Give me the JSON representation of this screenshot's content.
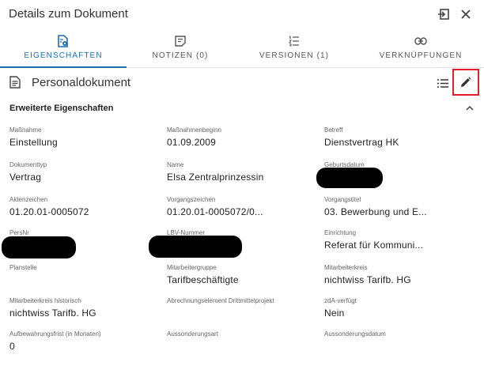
{
  "header": {
    "title": "Details zum Dokument"
  },
  "tabs": [
    {
      "label": "EIGENSCHAFTEN",
      "icon": "document-settings-icon",
      "active": true
    },
    {
      "label": "NOTIZEN (0)",
      "icon": "note-icon",
      "active": false
    },
    {
      "label": "VERSIONEN (1)",
      "icon": "versions-list-icon",
      "active": false
    },
    {
      "label": "VERKNÜPFUNGEN",
      "icon": "link-icon",
      "active": false
    }
  ],
  "document": {
    "title": "Personaldokument"
  },
  "section": {
    "title": "Erweiterte Eigenschaften"
  },
  "fields": [
    {
      "label": "Maßnahme",
      "value": "Einstellung"
    },
    {
      "label": "Maßnahmenbeginn",
      "value": "01.09.2009"
    },
    {
      "label": "Betreff",
      "value": "Dienstvertrag HK"
    },
    {
      "label": "Dokumenttyp",
      "value": "Vertrag"
    },
    {
      "label": "Name",
      "value": "Elsa Zentralprinzessin"
    },
    {
      "label": "Geburtsdatum",
      "value": ""
    },
    {
      "label": "Aktenzeichen",
      "value": "01.20.01-0005072"
    },
    {
      "label": "Vorgangszeichen",
      "value": "01.20.01-0005072/0..."
    },
    {
      "label": "Vorgangstitel",
      "value": "03. Bewerbung und E..."
    },
    {
      "label": "PersNr",
      "value": ""
    },
    {
      "label": "LBV-Nummer",
      "value": ""
    },
    {
      "label": "Einrichtung",
      "value": "Referat für Kommuni..."
    },
    {
      "label": "Planstelle",
      "value": ""
    },
    {
      "label": "Mitarbeitergruppe",
      "value": "Tarifbeschäftigte"
    },
    {
      "label": "Mitarbeiterkreis",
      "value": "nichtwiss Tarifb. HG"
    },
    {
      "label": "Mitarbeiterkreis historisch",
      "value": "nichtwiss Tarifb. HG"
    },
    {
      "label": "Abrechnungselement Drittmittelprojekt",
      "value": ""
    },
    {
      "label": "zdA-verfügt",
      "value": "Nein"
    },
    {
      "label": "Aufbewahrungsfrist (in Monaten)",
      "value": "0"
    },
    {
      "label": "Aussonderungsart",
      "value": ""
    },
    {
      "label": "Aussonderungsdatum",
      "value": ""
    }
  ],
  "colors": {
    "accent": "#1a6fb0",
    "highlight": "#e0202a"
  }
}
